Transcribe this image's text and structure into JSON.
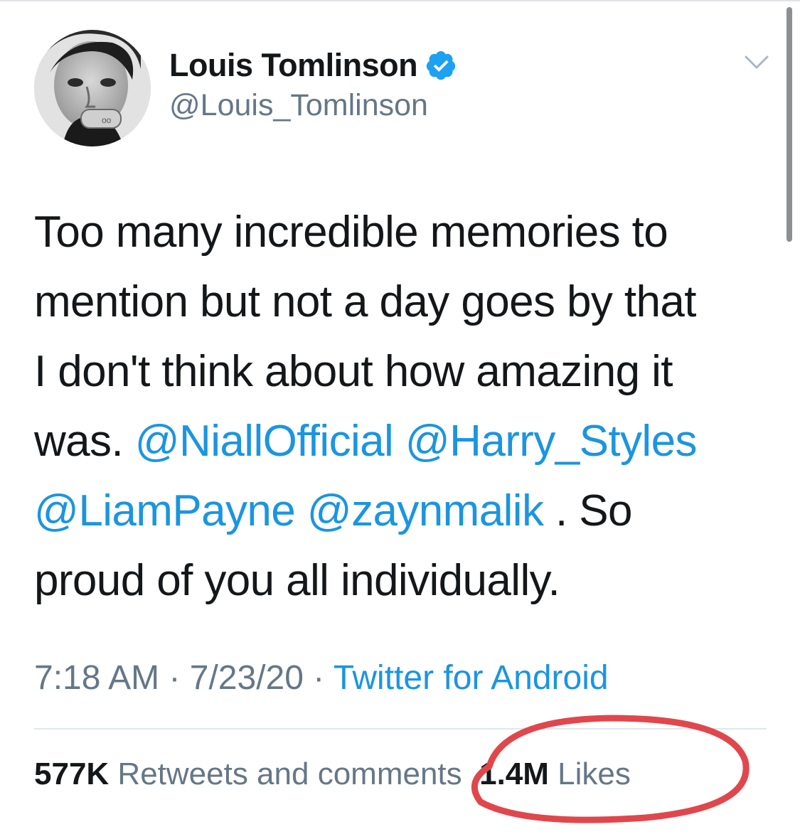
{
  "user": {
    "display_name": "Louis Tomlinson",
    "handle": "@Louis_Tomlinson",
    "verified": true
  },
  "icons": {
    "verified": "verified-badge-icon",
    "caret": "chevron-down-icon"
  },
  "tweet": {
    "line1": "Too many incredible memories to",
    "line2": "mention but not a day goes by that",
    "line3": "I don't think about how amazing it",
    "line4_prefix": "was. ",
    "mention1": "@NiallOfficial",
    "mention2": "@Harry_Styles",
    "mention3": "@LiamPayne",
    "mention4": "@zaynmalik",
    "line5_suffix": " . So",
    "line6": "proud of you all individually."
  },
  "meta": {
    "time": "7:18 AM",
    "sep": " · ",
    "date": "7/23/20",
    "source": "Twitter for Android"
  },
  "stats": {
    "retweets_count": "577K",
    "retweets_label": "Retweets and comments",
    "likes_count": "1.4M",
    "likes_label": "Likes"
  },
  "colors": {
    "link": "#1b95e0",
    "secondary_text": "#657786",
    "annotation_circle": "#e0474c"
  }
}
